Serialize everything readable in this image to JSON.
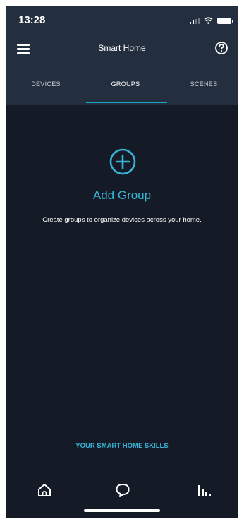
{
  "status_bar": {
    "time": "13:28",
    "icons": [
      "signal-icon",
      "wifi-icon",
      "battery-icon"
    ]
  },
  "header": {
    "title": "Smart Home",
    "menu_icon": "hamburger-menu-icon",
    "help_icon": "help-icon"
  },
  "tabs": [
    {
      "label": "DEVICES",
      "active": false
    },
    {
      "label": "GROUPS",
      "active": true
    },
    {
      "label": "SCENES",
      "active": false
    }
  ],
  "main": {
    "add_icon": "plus-circle-icon",
    "add_label": "Add Group",
    "description": "Create groups to organize devices across your home."
  },
  "skills_link": "YOUR SMART HOME SKILLS",
  "bottom_nav": [
    {
      "icon": "home-icon"
    },
    {
      "icon": "chat-icon"
    },
    {
      "icon": "stats-icon"
    }
  ],
  "colors": {
    "background": "#141b26",
    "header_bg": "#232f3e",
    "accent": "#39b4d6",
    "tab_indicator": "#1ea7c5"
  }
}
